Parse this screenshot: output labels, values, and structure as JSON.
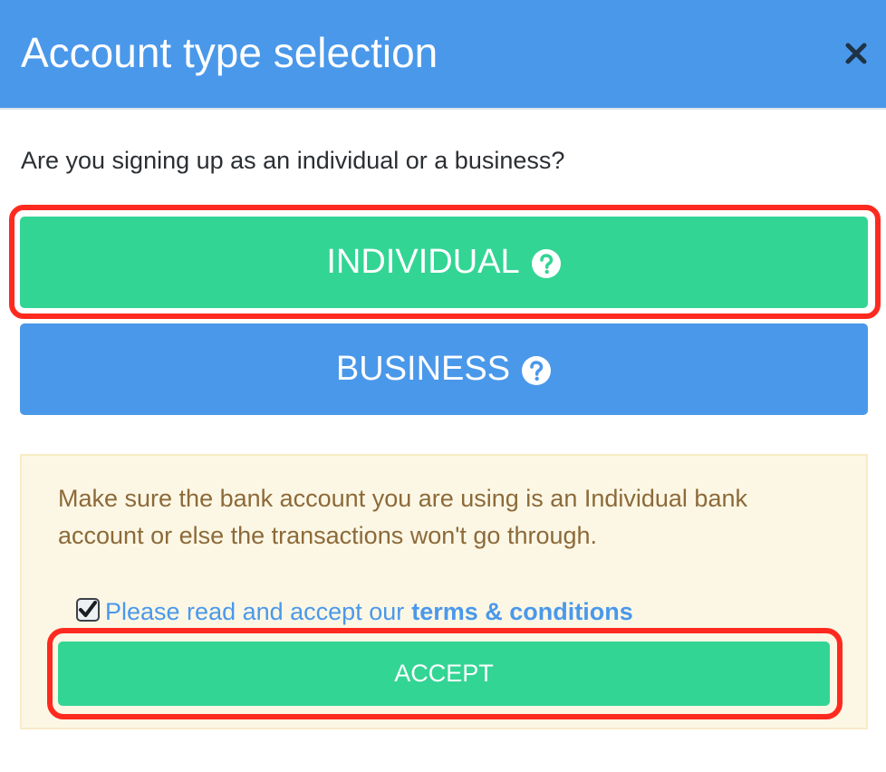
{
  "modal": {
    "title": "Account type selection",
    "close_icon": "close-icon"
  },
  "question": "Are you signing up as an individual or a business?",
  "account_types": {
    "individual": {
      "label": "INDIVIDUAL",
      "icon": "question-circle-icon",
      "color": "#33d594"
    },
    "business": {
      "label": "BUSINESS",
      "icon": "question-circle-icon",
      "color": "#4a98ea"
    }
  },
  "notice": {
    "message": "Make sure the bank account you are using is an Individual bank account or else the transactions won't go through.",
    "terms_prefix": "Please read and accept our",
    "terms_link": "terms & conditions",
    "checkbox_checked": true,
    "accept_label": "ACCEPT"
  },
  "colors": {
    "header": "#4a98ea",
    "primary_green": "#33d594",
    "highlight": "#ff2a1f",
    "notice_bg": "#fcf7e5",
    "notice_text": "#8c6a39"
  }
}
